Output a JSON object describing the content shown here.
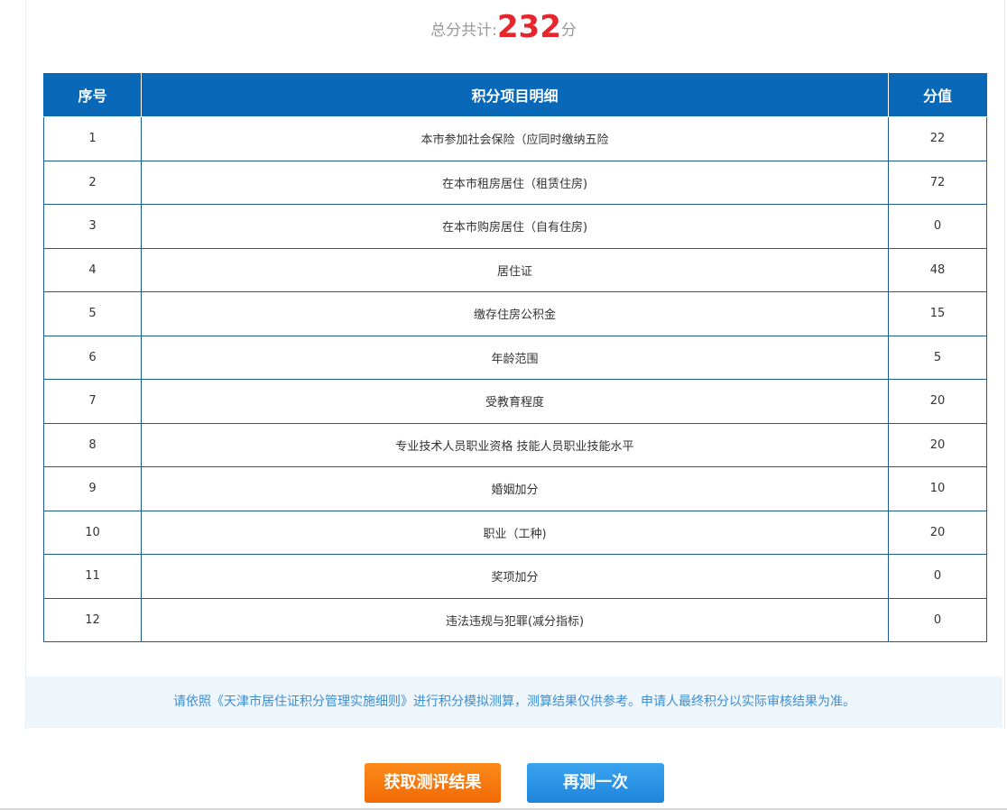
{
  "total": {
    "prefix": "总分共计:",
    "value": "232",
    "suffix": "分"
  },
  "table": {
    "headers": [
      "序号",
      "积分项目明细",
      "分值"
    ],
    "rows": [
      {
        "no": "1",
        "item": "本市参加社会保险（应同时缴纳五险",
        "score": "22"
      },
      {
        "no": "2",
        "item": "在本市租房居住（租赁住房)",
        "score": "72"
      },
      {
        "no": "3",
        "item": "在本市购房居住（自有住房)",
        "score": "0"
      },
      {
        "no": "4",
        "item": "居住证",
        "score": "48"
      },
      {
        "no": "5",
        "item": "缴存住房公积金",
        "score": "15"
      },
      {
        "no": "6",
        "item": "年龄范围",
        "score": "5"
      },
      {
        "no": "7",
        "item": "受教育程度",
        "score": "20"
      },
      {
        "no": "8",
        "item": "专业技术人员职业资格 技能人员职业技能水平",
        "score": "20"
      },
      {
        "no": "9",
        "item": "婚姻加分",
        "score": "10"
      },
      {
        "no": "10",
        "item": "职业（工种)",
        "score": "20"
      },
      {
        "no": "11",
        "item": "奖项加分",
        "score": "0"
      },
      {
        "no": "12",
        "item": "违法违规与犯罪(减分指标)",
        "score": "0"
      }
    ]
  },
  "notice": "请依照《天津市居住证积分管理实施细则》进行积分模拟测算，测算结果仅供参考。申请人最终积分以实际审核结果为准。",
  "buttons": {
    "get_result": "获取测评结果",
    "retry": "再测一次"
  },
  "colors": {
    "header_bg": "#0a68b8",
    "score_red": "#e5262d",
    "orange_button": "#f36a06",
    "blue_button": "#1f86dd",
    "notice_text": "#3d8dd1"
  }
}
